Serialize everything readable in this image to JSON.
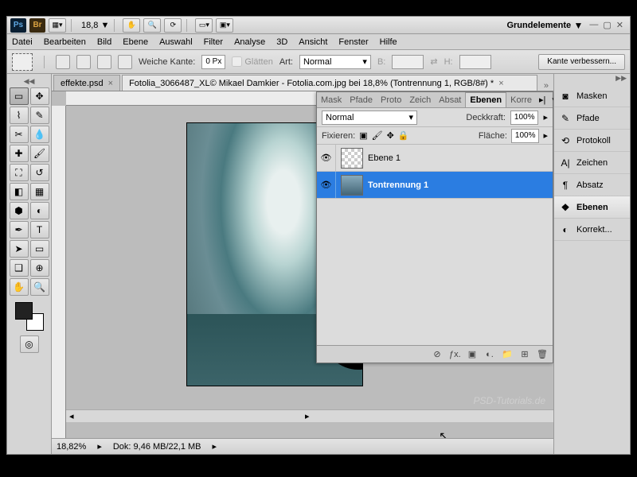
{
  "titlebar": {
    "zoom_dropdown": "18,8",
    "workspace": "Grundelemente"
  },
  "menu": {
    "items": [
      "Datei",
      "Bearbeiten",
      "Bild",
      "Ebene",
      "Auswahl",
      "Filter",
      "Analyse",
      "3D",
      "Ansicht",
      "Fenster",
      "Hilfe"
    ]
  },
  "options_bar": {
    "feather_label": "Weiche Kante:",
    "feather_value": "0 Px",
    "antialias_label": "Glätten",
    "style_label": "Art:",
    "style_value": "Normal",
    "width_label": "B:",
    "height_label": "H:",
    "refine_button": "Kante verbessern..."
  },
  "document_tabs": {
    "tab1": "effekte.psd",
    "tab2": "Fotolia_3066487_XL© Mikael Damkier - Fotolia.com.jpg bei 18,8% (Tontrennung 1, RGB/8#) *"
  },
  "status_bar": {
    "zoom": "18,82%",
    "doc_label": "Dok:",
    "doc_size": "9,46 MB/22,1 MB"
  },
  "layers_panel": {
    "tabs": [
      "Mask",
      "Pfade",
      "Proto",
      "Zeich",
      "Absat",
      "Ebenen",
      "Korre"
    ],
    "blend_mode": "Normal",
    "opacity_label": "Deckkraft:",
    "opacity_value": "100%",
    "lock_label": "Fixieren:",
    "fill_label": "Fläche:",
    "fill_value": "100%",
    "layers": [
      {
        "name": "Ebene 1"
      },
      {
        "name": "Tontrennung 1"
      }
    ]
  },
  "right_panels": {
    "items": [
      "Masken",
      "Pfade",
      "Protokoll",
      "Zeichen",
      "Absatz",
      "Ebenen",
      "Korrekt..."
    ]
  },
  "watermark": "PSD-Tutorials.de"
}
